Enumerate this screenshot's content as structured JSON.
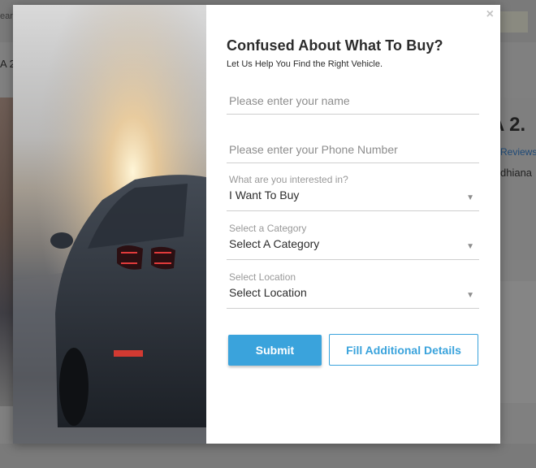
{
  "background": {
    "search_fragment": "ear",
    "left_fragment": "A 2.",
    "title_fragment": "A 2.",
    "reviews_fragment": "Reviews",
    "city_fragment": "dhiana"
  },
  "modal": {
    "close_glyph": "×",
    "title": "Confused About What To Buy?",
    "subtitle": "Let Us Help You Find the Right Vehicle.",
    "fields": {
      "name": {
        "placeholder": "Please enter your name"
      },
      "phone": {
        "placeholder": "Please enter your Phone Number"
      },
      "interest": {
        "label": "What are you interested in?",
        "value": "I Want To Buy"
      },
      "category": {
        "label": "Select a Category",
        "value": "Select A Category"
      },
      "location": {
        "label": "Select Location",
        "value": "Select Location"
      }
    },
    "dropdown_glyph": "▼",
    "buttons": {
      "submit": "Submit",
      "details": "Fill Additional Details"
    }
  },
  "colors": {
    "accent": "#3aa3dc",
    "overlay": "#808080"
  }
}
